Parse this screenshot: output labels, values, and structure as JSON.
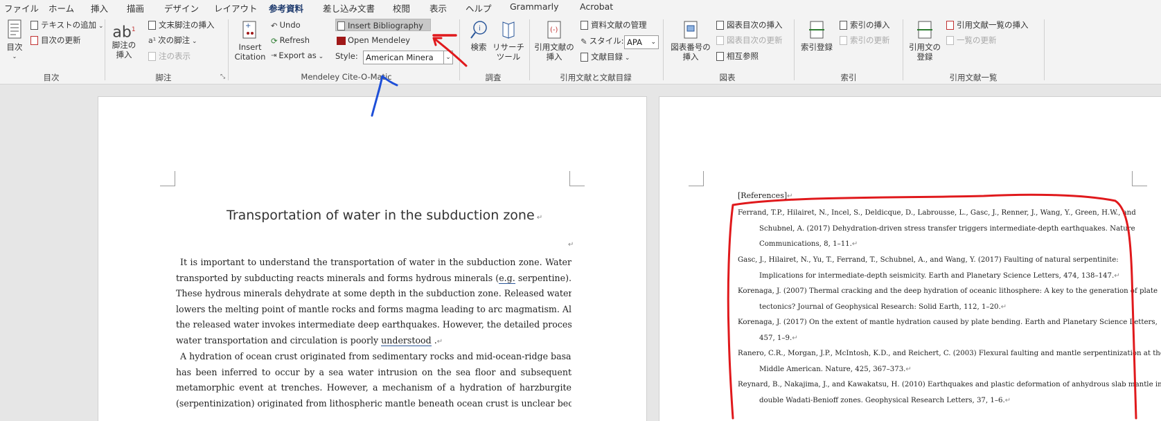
{
  "menu": {
    "tabs": [
      "ファイル",
      "ホーム",
      "挿入",
      "描画",
      "デザイン",
      "レイアウト",
      "参考資料",
      "差し込み文書",
      "校閲",
      "表示",
      "ヘルプ",
      "Grammarly",
      "Acrobat"
    ],
    "active_tab": "参考資料"
  },
  "ribbon": {
    "toc": {
      "big_label": "目次",
      "add_text": "テキストの追加",
      "update": "目次の更新",
      "group": "目次"
    },
    "footnotes": {
      "insert_footnote_l1": "脚注の",
      "insert_footnote_l2": "挿入",
      "insert_endnote": "文末脚注の挿入",
      "next_footnote": "次の脚注",
      "show_notes": "注の表示",
      "group": "脚注"
    },
    "mendeley": {
      "insert_citation_l1": "Insert",
      "insert_citation_l2": "Citation",
      "undo": "Undo",
      "refresh": "Refresh",
      "export_as": "Export as",
      "insert_bibliography": "Insert Bibliography",
      "open_mendeley": "Open Mendeley",
      "style_label": "Style:",
      "style_value": "American Minera",
      "group": "Mendeley Cite-O-Matic"
    },
    "research": {
      "search": "検索",
      "researcher_l1": "リサーチ",
      "researcher_l2": "ツール",
      "group": "調査"
    },
    "citations": {
      "insert_citation_l1": "引用文献の",
      "insert_citation_l2": "挿入",
      "manage_sources": "資料文献の管理",
      "style_label": "スタイル:",
      "style_value": "APA",
      "bibliography": "文献目録",
      "group": "引用文献と文献目録"
    },
    "captions": {
      "insert_caption_l1": "図表番号の",
      "insert_caption_l2": "挿入",
      "insert_table_of_figures": "図表目次の挿入",
      "update_table": "図表目次の更新",
      "cross_reference": "相互参照",
      "group": "図表"
    },
    "index": {
      "mark_entry": "索引登録",
      "insert_index": "索引の挿入",
      "update_index": "索引の更新",
      "group": "索引"
    },
    "authorities": {
      "mark_citation_l1": "引用文の",
      "mark_citation_l2": "登録",
      "insert_table": "引用文献一覧の挿入",
      "update_table": "一覧の更新",
      "group": "引用文献一覧"
    }
  },
  "document": {
    "title": "Transportation of water in the subduction zone",
    "paragraph1": [
      "It is important to understand the transportation of water in the subduction zone. Water",
      "transported by subducting reacts minerals and forms hydrous minerals (",
      "e.g.",
      " serpentine).",
      "These hydrous minerals dehydrate at some depth in the subduction zone. Released water",
      "lowers the melting point of mantle rocks and forms magma leading to arc magmatism. Also,",
      "the released water invokes intermediate deep earthquakes. However, the detailed process of",
      "water transportation and circulation is poorly ",
      "understood",
      " ."
    ],
    "paragraph2": [
      "A hydration of ocean crust originated from sedimentary rocks and mid-ocean-ridge basalt",
      "has been inferred to occur by a sea water intrusion on the sea floor and subsequent",
      "metamorphic event at trenches. However, a mechanism of a hydration of harzburgite",
      "(serpentinization) originated from lithospheric mantle beneath ocean crust is unclear because"
    ],
    "references_heading": "[References]",
    "references": [
      [
        "Ferrand, T.P., Hilairet, N., Incel, S., Deldicque, D., Labrousse, L., Gasc, J., Renner, J., Wang, Y., Green, H.W., and",
        "Schubnel, A. (2017) Dehydration-driven stress transfer triggers intermediate-depth earthquakes. Nature",
        "Communications, 8, 1–11."
      ],
      [
        "Gasc, J., Hilairet, N., Yu, T., Ferrand, T., Schubnel, A., and Wang, Y. (2017) Faulting of natural serpentinite:",
        "Implications for intermediate-depth seismicity. Earth and Planetary Science Letters, 474, 138–147."
      ],
      [
        "Korenaga, J. (2007) Thermal cracking and the deep hydration of oceanic lithosphere: A key to the generation of plate",
        "tectonics? Journal of Geophysical Research: Solid Earth, 112, 1–20."
      ],
      [
        "Korenaga, J. (2017) On the extent of mantle hydration caused by plate bending. Earth and Planetary Science Letters,",
        "457, 1–9."
      ],
      [
        "Ranero, C.R., Morgan, J.P., McIntosh, K.D., and Reichert, C. (2003) Flexural faulting and mantle serpentinization at the",
        "Middle American. Nature, 425, 367–373."
      ],
      [
        "Reynard, B., Nakajima, J., and Kawakatsu, H. (2010) Earthquakes and plastic deformation of anhydrous slab mantle in",
        "double Wadati-Benioff zones. Geophysical Research Letters, 37, 1–6."
      ]
    ]
  },
  "colors": {
    "annotation_red": "#e0191c",
    "annotation_blue": "#1e4fd8",
    "accent": "#2b579a"
  }
}
